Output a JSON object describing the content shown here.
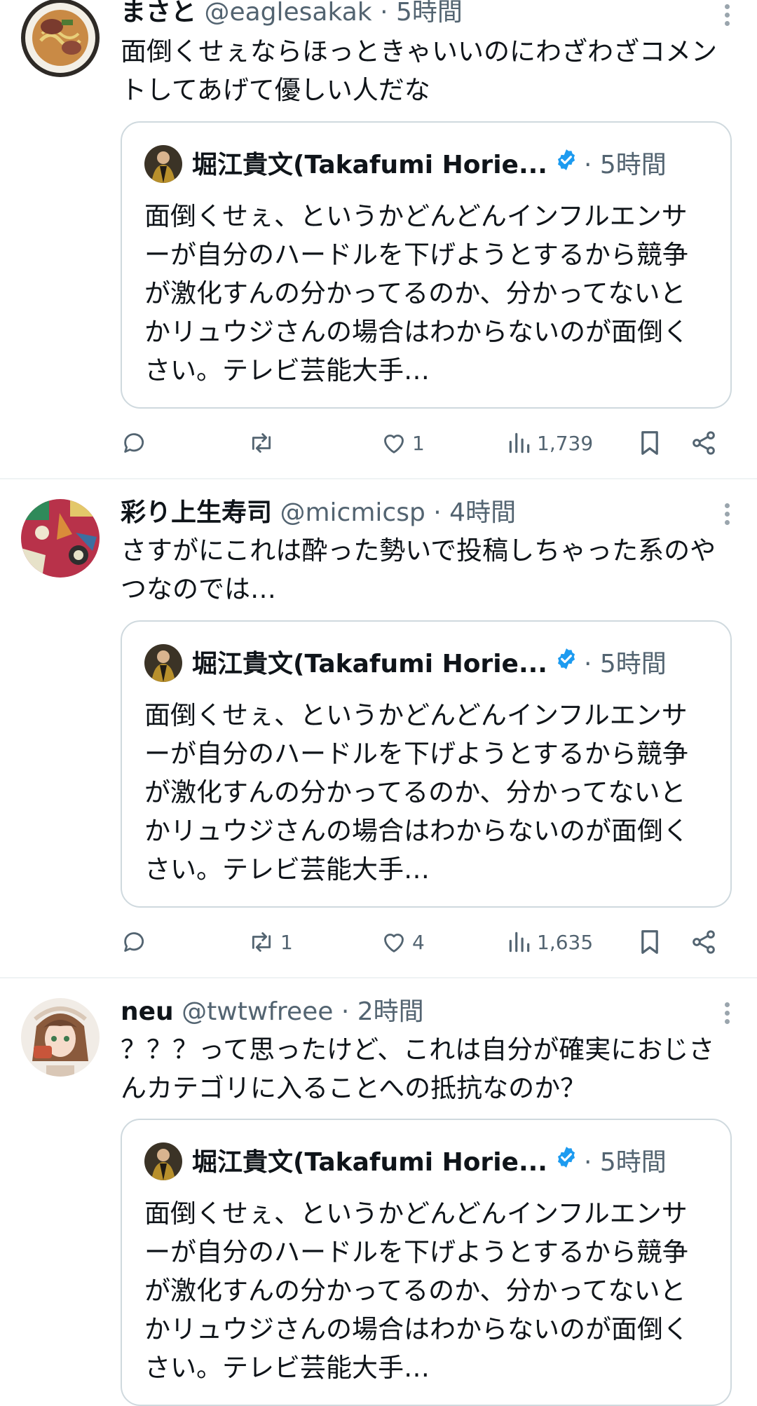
{
  "tweets": [
    {
      "name": "まさと",
      "handle": "@eaglesakak",
      "sep": "·",
      "time": "5時間",
      "text": "面倒くせぇならほっときゃいいのにわざわざコメントしてあげて優しい人だな",
      "avatar_icon": "ramen-avatar-icon",
      "quote": {
        "name": "堀江貴文(Takafumi Horie...",
        "time": "· 5時間",
        "text": "面倒くせぇ、というかどんどんインフルエンサーが自分のハードルを下げようとするから競争が激化すんの分かってるのか、分かってないとかリュウジさんの場合はわからないのが面倒くさい。テレビ芸能大手…"
      },
      "stats": {
        "replies": "",
        "retweets": "",
        "likes": "1",
        "views": "1,739"
      }
    },
    {
      "name": "彩り上生寿司",
      "handle": "@micmicsp",
      "sep": "·",
      "time": "4時間",
      "text": "さすがにこれは酔った勢いで投稿しちゃった系のやつなのでは…",
      "avatar_icon": "pattern-avatar-icon",
      "quote": {
        "name": "堀江貴文(Takafumi Horie...",
        "time": "· 5時間",
        "text": "面倒くせぇ、というかどんどんインフルエンサーが自分のハードルを下げようとするから競争が激化すんの分かってるのか、分かってないとかリュウジさんの場合はわからないのが面倒くさい。テレビ芸能大手…"
      },
      "stats": {
        "replies": "",
        "retweets": "1",
        "likes": "4",
        "views": "1,635"
      }
    },
    {
      "name": "neu",
      "handle": "@twtwfreee",
      "sep": "·",
      "time": "2時間",
      "text": "？？？って思ったけど、これは自分が確実におじさんカテゴリに入ることへの抵抗なのか？",
      "avatar_icon": "anime-girl-avatar-icon",
      "quote": {
        "name": "堀江貴文(Takafumi Horie...",
        "time": "· 5時間",
        "text": "面倒くせぇ、というかどんどんインフルエンサーが自分のハードルを下げようとするから競争が激化すんの分かってるのか、分かってないとかリュウジさんの場合はわからないのが面倒くさい。テレビ芸能大手…"
      }
    }
  ],
  "colors": {
    "text_primary": "#0f1419",
    "text_secondary": "#536471",
    "verified": "#1d9bf0",
    "border": "#cfd9de",
    "divider": "#eff3f4"
  }
}
